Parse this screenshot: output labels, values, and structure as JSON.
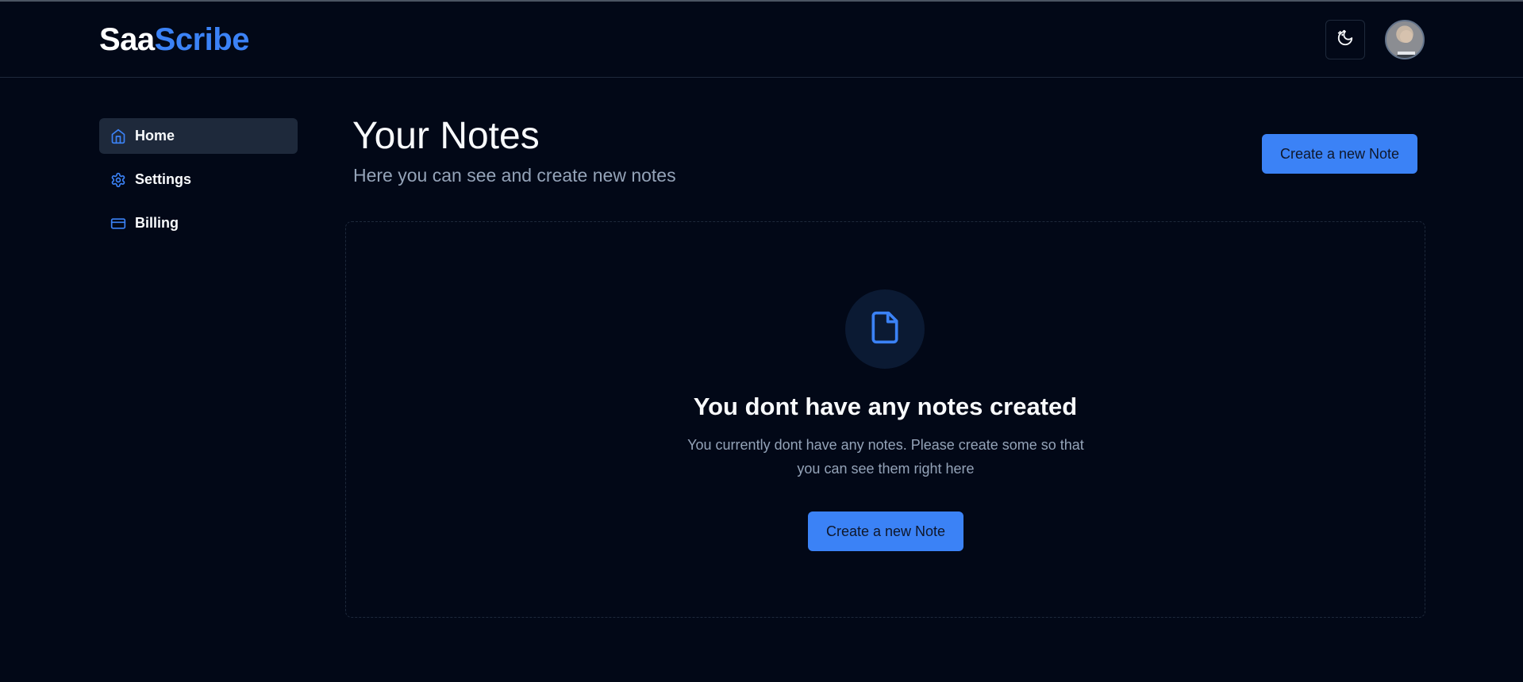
{
  "header": {
    "logo_part1": "Saa",
    "logo_part2": "Scribe",
    "theme_toggle_icon": "moon-sun-icon",
    "avatar_icon": "user-avatar"
  },
  "sidebar": {
    "items": [
      {
        "label": "Home",
        "icon": "home-icon",
        "active": true
      },
      {
        "label": "Settings",
        "icon": "gear-icon",
        "active": false
      },
      {
        "label": "Billing",
        "icon": "credit-card-icon",
        "active": false
      }
    ]
  },
  "main": {
    "title": "Your Notes",
    "subtitle": "Here you can see and create new notes",
    "create_button": "Create a new Note",
    "empty_state": {
      "icon": "file-icon",
      "title": "You dont have any notes created",
      "description": "You currently dont have any notes. Please create some so that you can see them right here",
      "button": "Create a new Note"
    }
  },
  "colors": {
    "background": "#020817",
    "accent": "#3b82f6",
    "muted_text": "#94a3b8",
    "border": "#1e293b"
  }
}
